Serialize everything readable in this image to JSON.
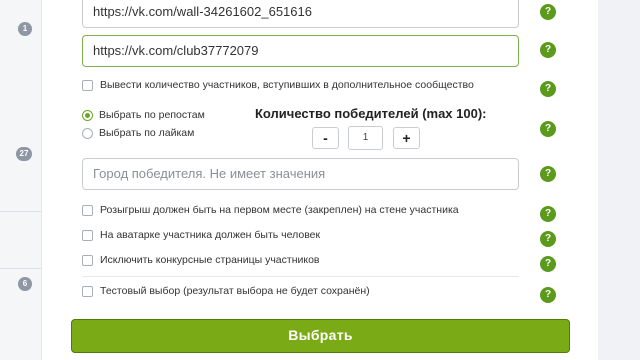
{
  "sidebar": {
    "counts": [
      "1",
      "27",
      "6"
    ]
  },
  "form": {
    "post_url": "https://vk.com/wall-34261602_651616",
    "club_url": "https://vk.com/club37772079",
    "show_extra_community_label": "Вывести количество участников, вступивших в дополнительное сообщество",
    "by_reposts_label": "Выбрать по репостам",
    "by_likes_label": "Выбрать по лайкам",
    "winners_title": "Количество победителей (max 100):",
    "winners_minus": "-",
    "winners_value": "1",
    "winners_plus": "+",
    "city_placeholder": "Город победителя. Не имеет значения",
    "pinned_label": "Розыгрыш должен быть на первом месте (закреплен) на стене участника",
    "avatar_label": "На аватарке участника должен быть человек",
    "exclude_label": "Исключить конкурсные страницы участников",
    "test_label": "Тестовый выбор (результат выбора не будет сохранён)",
    "submit_label": "Выбрать",
    "help_glyph": "?"
  },
  "colors": {
    "accent": "#7aab17",
    "help": "#5c9a1e",
    "active_border": "#7fb24a"
  }
}
